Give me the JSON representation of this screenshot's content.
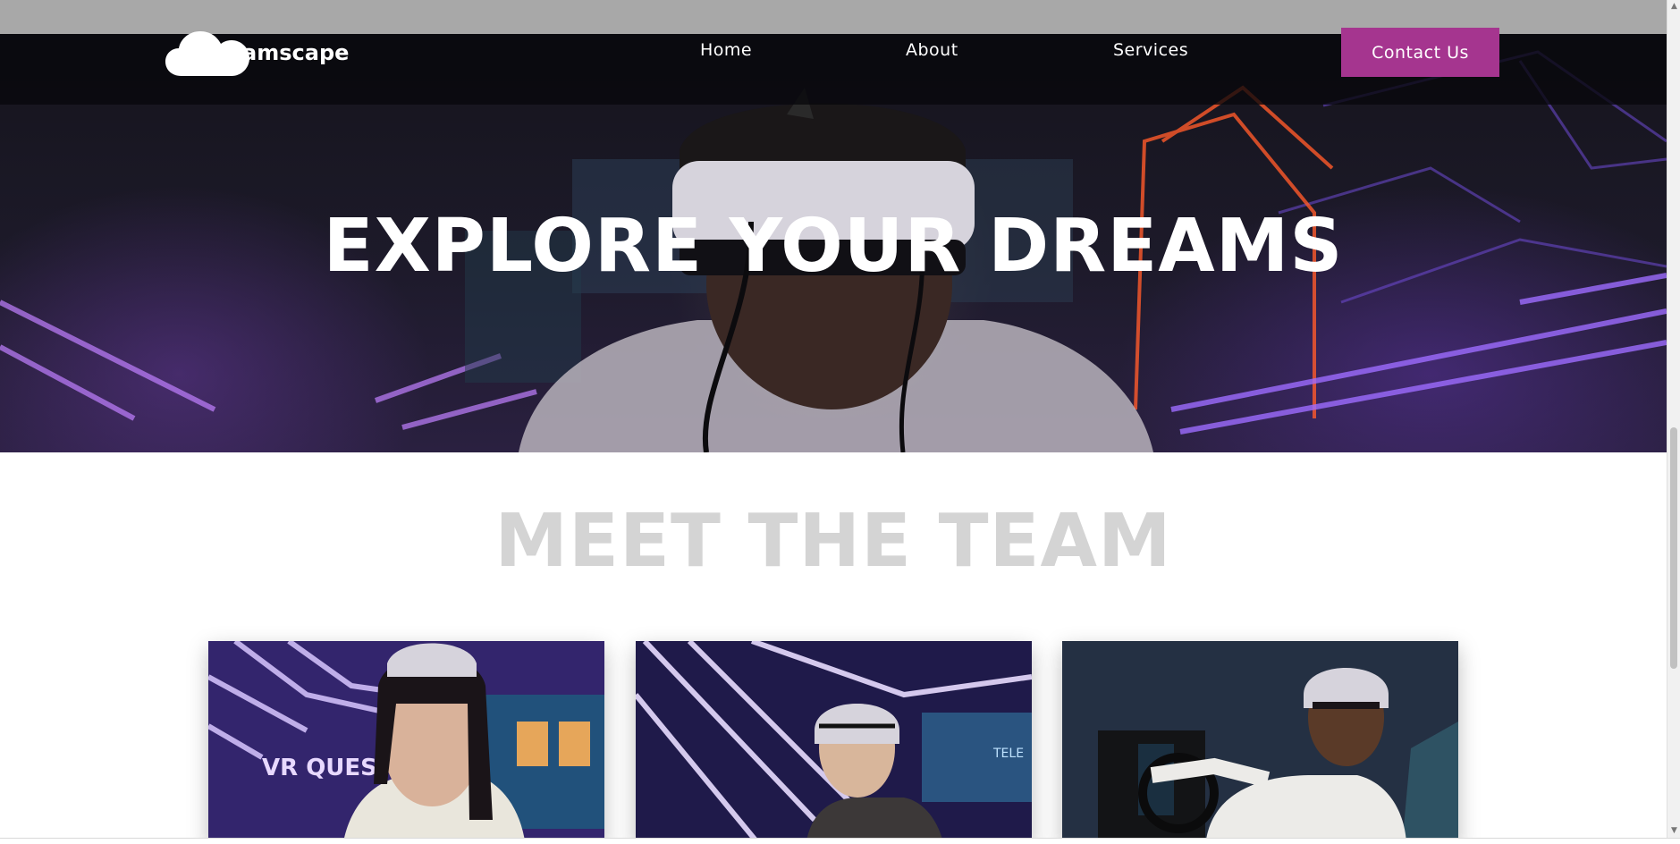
{
  "brand": {
    "name": "Dreamscape",
    "logo_icon": "cloud-icon"
  },
  "nav": {
    "items": [
      {
        "label": "Home"
      },
      {
        "label": "About"
      },
      {
        "label": "Services"
      }
    ],
    "cta_label": "Contact Us"
  },
  "hero": {
    "title": "EXPLORE YOUR DREAMS"
  },
  "team": {
    "title": "MEET THE TEAM",
    "cards": [
      {
        "photo": "team-member-photo-1",
        "sign_text": "VR QUEST"
      },
      {
        "photo": "team-member-photo-2",
        "sign_text": "TELE"
      },
      {
        "photo": "team-member-photo-3"
      }
    ]
  },
  "colors": {
    "accent": "#a5358f",
    "nav_bg": "#0a0a0e",
    "hero_title": "#ffffff",
    "team_title": "#d4d4d4",
    "neon_purple": "#8a5cf0",
    "neon_orange": "#ff5a2a"
  }
}
